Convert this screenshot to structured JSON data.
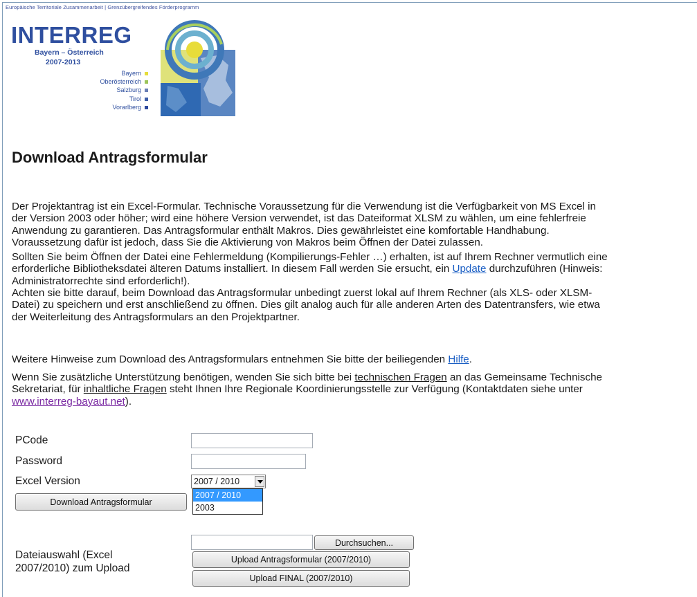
{
  "logo": {
    "tagline": "Europäische Territoriale Zusammenarbeit | Grenzübergreifendes Förderprogramm",
    "title": "INTERREG",
    "subtitle": "Bayern – Österreich",
    "years": "2007-2013",
    "regions": [
      {
        "name": "Bayern",
        "color": "#e6dd3c"
      },
      {
        "name": "Oberösterreich",
        "color": "#9bc45a"
      },
      {
        "name": "Salzburg",
        "color": "#6a7fb5"
      },
      {
        "name": "Tirol",
        "color": "#3d5ea8"
      },
      {
        "name": "Vorarlberg",
        "color": "#2e4a9e"
      }
    ]
  },
  "page": {
    "title": "Download Antragsformular",
    "p1": [
      "Der Projektantrag ist ein Excel-Formular. Technische Voraussetzung für die Verwendung ist die Verfügbarkeit von MS Excel in",
      "der Version 2003 oder höher; wird eine höhere Version verwendet, ist das Dateiformat XLSM zu wählen, um eine fehlerfreie",
      "Anwendung zu garantieren. Das Antragsformular enthält Makros. Dies gewährleistet eine komfortable Handhabung.",
      "Voraussetzung dafür ist jedoch, dass Sie die Aktivierung von Makros beim Öffnen der Datei zulassen."
    ],
    "p2_line1": "Sollten Sie beim Öffnen der Datei eine Fehlermeldung (Kompilierungs-Fehler …) erhalten, ist auf Ihrem Rechner vermutlich eine",
    "p2_line2_pre": "erforderliche Bibliotheksdatei älteren Datums installiert. In diesem Fall werden Sie ersucht, ein ",
    "p2_update_link": "Update",
    "p2_line2_post": " durchzuführen (Hinweis:",
    "p2_line3": "Administratorrechte sind erforderlich!).",
    "p3": [
      "Achten sie bitte darauf, beim Download das Antragsformular unbedingt zuerst lokal auf Ihrem Rechner (als XLS- oder XLSM-",
      "Datei) zu speichern und erst anschließend zu öffnen. Dies gilt analog auch für alle anderen Arten des Datentransfers, wie etwa",
      "der Weiterleitung des Antragsformulars an den Projektpartner."
    ],
    "p4_pre": "Weitere Hinweise zum Download des Antragsformulars entnehmen Sie bitte der beiliegenden ",
    "p4_link": "Hilfe",
    "p4_post": ".",
    "p5_line1_pre": "Wenn Sie zusätzliche Unterstützung benötigen, wenden Sie sich bitte bei ",
    "p5_tech": "technischen Fragen",
    "p5_line1_post": " an das Gemeinsame Technische",
    "p5_line2_pre": "Sekretariat, für ",
    "p5_inhalt": "inhaltliche Fragen",
    "p5_line2_post": " steht Ihnen Ihre Regionale Koordinierungsstelle zur Verfügung (Kontaktdaten siehe unter",
    "p5_url": "www.interreg-bayaut.net",
    "p5_end": ")."
  },
  "form": {
    "pcode_label": "PCode",
    "pcode_value": "",
    "password_label": "Password",
    "password_value": "",
    "excel_label": "Excel Version",
    "excel_selected": "2007 / 2010",
    "excel_options": [
      "2007 / 2010",
      "2003"
    ],
    "download_button": "Download Antragsformular",
    "file_value": "",
    "browse_button": "Durchsuchen...",
    "upload_label_line1": "Dateiauswahl (Excel",
    "upload_label_line2": "2007/2010) zum Upload",
    "upload_button": "Upload Antragsformular (2007/2010)",
    "upload_final_button": "Upload FINAL (2007/2010)"
  }
}
